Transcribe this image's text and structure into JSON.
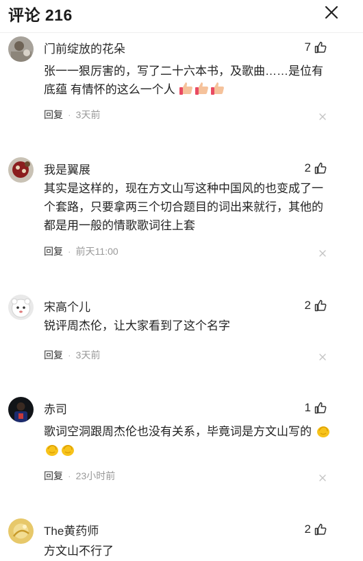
{
  "header": {
    "title": "评论 216",
    "close_icon": "close-icon"
  },
  "comments": [
    {
      "username": "门前绽放的花朵",
      "likes": "7",
      "text": "张一一狠厉害的，写了二十六本书，及歌曲……是位有底蕴 有情怀的这么一个人",
      "emojis": [
        "thumbs-up-emoji",
        "thumbs-up-emoji",
        "thumbs-up-emoji"
      ],
      "reply_label": "回复",
      "time": "3天前"
    },
    {
      "username": "我是翼展",
      "likes": "2",
      "text": "其实是这样的，现在方文山写这种中国风的也变成了一个套路，只要拿两三个切合题目的词出来就行，其他的都是用一般的情歌歌词往上套",
      "reply_label": "回复",
      "time": "前天11:00"
    },
    {
      "username": "宋高个儿",
      "likes": "2",
      "text": "锐评周杰伦，让大家看到了这个名字",
      "reply_label": "回复",
      "time": "3天前"
    },
    {
      "username": "赤司",
      "likes": "1",
      "text": "歌词空洞跟周杰伦也没有关系，毕竟词是方文山写的",
      "emojis": [
        "clapping-hands-emoji",
        "clapping-hands-emoji",
        "clapping-hands-emoji"
      ],
      "reply_label": "回复",
      "time": "23小时前"
    },
    {
      "username": "The黄药师",
      "likes": "2",
      "text": "方文山不行了"
    }
  ],
  "colors": {
    "text": "#222222",
    "meta": "#999999",
    "emoji_skin": "#f5c29b",
    "emoji_cuff": "#e94b63",
    "clap_yellow": "#f7c31b"
  }
}
